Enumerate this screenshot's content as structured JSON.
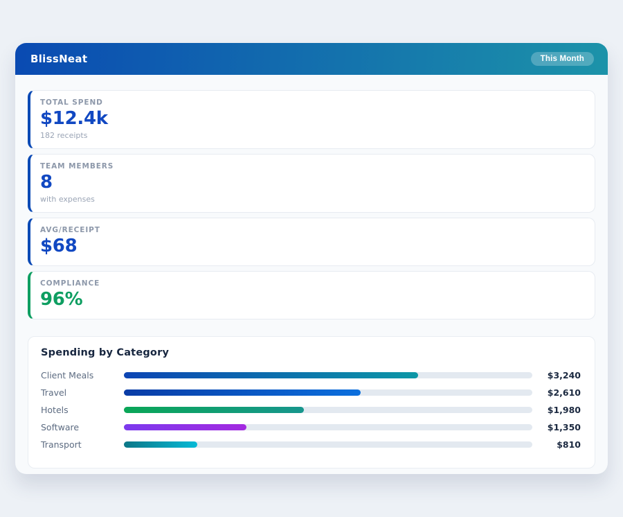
{
  "header": {
    "app_title": "BlissNeat",
    "period_badge": "This Month"
  },
  "stats": [
    {
      "label": "TOTAL SPEND",
      "value": "$12.4k",
      "subtext": "182 receipts",
      "accent_color": "#0b4ab5",
      "value_color": "#1148c2"
    },
    {
      "label": "TEAM MEMBERS",
      "value": "8",
      "subtext": "with expenses",
      "accent_color": "#0b4ab5",
      "value_color": "#1148c2"
    },
    {
      "label": "AVG/RECEIPT",
      "value": "$68",
      "subtext": "",
      "accent_color": "#0b4ab5",
      "value_color": "#1148c2"
    },
    {
      "label": "COMPLIANCE",
      "value": "96%",
      "subtext": "",
      "accent_color": "#0e9e61",
      "value_color": "#0e9e61"
    }
  ],
  "chart_data": {
    "type": "bar",
    "orientation": "horizontal",
    "title": "Spending by Category",
    "categories": [
      "Client Meals",
      "Travel",
      "Hotels",
      "Software",
      "Transport"
    ],
    "values": [
      3240,
      2610,
      1980,
      1350,
      810
    ],
    "value_labels": [
      "$3,240",
      "$2,610",
      "$1,980",
      "$1,350",
      "$810"
    ],
    "bar_percents": [
      72,
      58,
      44,
      30,
      18
    ],
    "bar_gradients": [
      [
        "#0d45b4",
        "#0d97a6"
      ],
      [
        "#0a3ca6",
        "#0b6fdd"
      ],
      [
        "#0aa657",
        "#17968d"
      ],
      [
        "#7c3aed",
        "#a32ae0"
      ],
      [
        "#0d7787",
        "#06b9d6"
      ]
    ],
    "track_color": "#e3e9f0",
    "xlim": [
      0,
      4500
    ],
    "grid": false,
    "legend": false
  },
  "colors": {
    "page_bg": "#edf1f6",
    "panel_bg": "#f8fafc",
    "header_gradient_start": "#0a4ab2",
    "header_gradient_end": "#1c93a9"
  }
}
